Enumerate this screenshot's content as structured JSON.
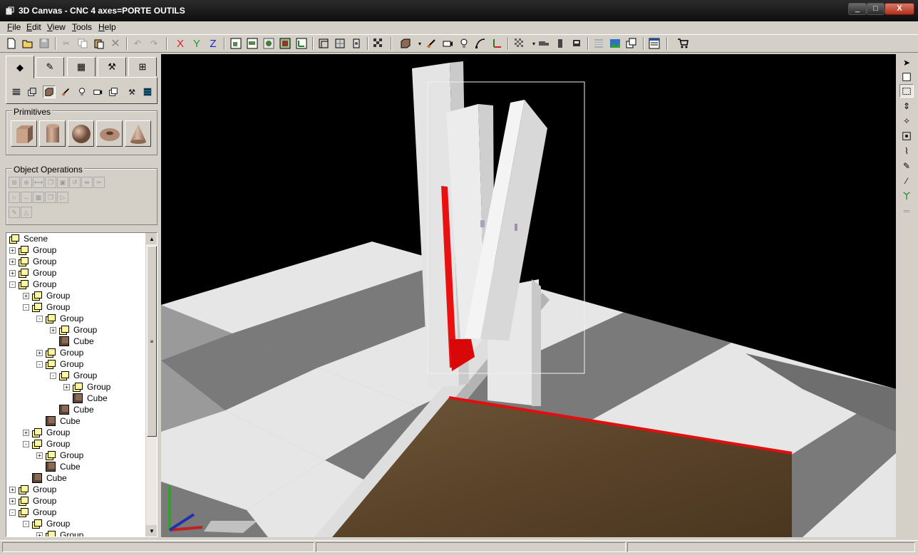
{
  "window": {
    "title": "3D Canvas - CNC 4 axes=PORTE OUTILS",
    "min_label": "_",
    "max_label": "□",
    "close_label": "X"
  },
  "menu": [
    {
      "label": "File",
      "accel": "F",
      "rest": "ile"
    },
    {
      "label": "Edit",
      "accel": "E",
      "rest": "dit"
    },
    {
      "label": "View",
      "accel": "V",
      "rest": "iew"
    },
    {
      "label": "Tools",
      "accel": "T",
      "rest": "ools"
    },
    {
      "label": "Help",
      "accel": "H",
      "rest": "elp"
    }
  ],
  "toolbar": {
    "axis_x": "X",
    "axis_y": "Y",
    "axis_z": "Z",
    "axis_colors": {
      "x": "#e02020",
      "y": "#20a020",
      "z": "#2020d0"
    }
  },
  "left_panel": {
    "primitives_label": "Primitives",
    "primitives": [
      "cube",
      "cylinder",
      "sphere",
      "torus",
      "cone"
    ],
    "object_operations_label": "Object Operations"
  },
  "tree": [
    {
      "label": "Scene",
      "type": "group",
      "depth": 0,
      "expander": ""
    },
    {
      "label": "Group",
      "type": "group",
      "depth": 0,
      "expander": "+"
    },
    {
      "label": "Group",
      "type": "group",
      "depth": 0,
      "expander": "+"
    },
    {
      "label": "Group",
      "type": "group",
      "depth": 0,
      "expander": "+"
    },
    {
      "label": "Group",
      "type": "group",
      "depth": 0,
      "expander": "-"
    },
    {
      "label": "Group",
      "type": "group",
      "depth": 1,
      "expander": "+"
    },
    {
      "label": "Group",
      "type": "group",
      "depth": 1,
      "expander": "-"
    },
    {
      "label": "Group",
      "type": "group",
      "depth": 2,
      "expander": "-"
    },
    {
      "label": "Group",
      "type": "group",
      "depth": 3,
      "expander": "+"
    },
    {
      "label": "Cube",
      "type": "cube",
      "depth": 3,
      "expander": ""
    },
    {
      "label": "Group",
      "type": "group",
      "depth": 2,
      "expander": "+"
    },
    {
      "label": "Group",
      "type": "group",
      "depth": 2,
      "expander": "-"
    },
    {
      "label": "Group",
      "type": "group",
      "depth": 3,
      "expander": "-"
    },
    {
      "label": "Group",
      "type": "group",
      "depth": 4,
      "expander": "+"
    },
    {
      "label": "Cube",
      "type": "cube",
      "depth": 4,
      "expander": ""
    },
    {
      "label": "Cube",
      "type": "cube",
      "depth": 3,
      "expander": ""
    },
    {
      "label": "Cube",
      "type": "cube",
      "depth": 2,
      "expander": ""
    },
    {
      "label": "Group",
      "type": "group",
      "depth": 1,
      "expander": "+"
    },
    {
      "label": "Group",
      "type": "group",
      "depth": 1,
      "expander": "-"
    },
    {
      "label": "Group",
      "type": "group",
      "depth": 2,
      "expander": "+"
    },
    {
      "label": "Cube",
      "type": "cube",
      "depth": 2,
      "expander": ""
    },
    {
      "label": "Cube",
      "type": "cube",
      "depth": 1,
      "expander": ""
    },
    {
      "label": "Group",
      "type": "group",
      "depth": 0,
      "expander": "+"
    },
    {
      "label": "Group",
      "type": "group",
      "depth": 0,
      "expander": "+"
    },
    {
      "label": "Group",
      "type": "group",
      "depth": 0,
      "expander": "-"
    },
    {
      "label": "Group",
      "type": "group",
      "depth": 1,
      "expander": "-"
    },
    {
      "label": "Group",
      "type": "group",
      "depth": 2,
      "expander": "+"
    }
  ],
  "statusbar": {
    "panel1": "",
    "panel2": "",
    "panel3": ""
  }
}
